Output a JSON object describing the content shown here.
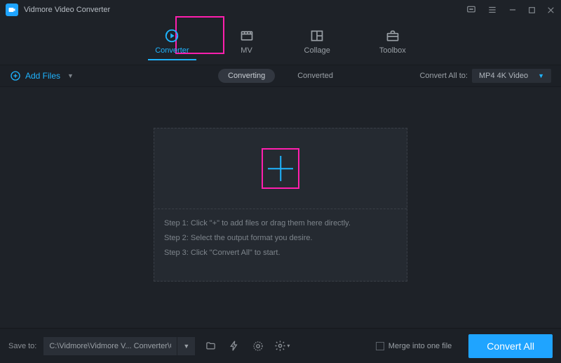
{
  "app": {
    "title": "Vidmore Video Converter"
  },
  "tabs": {
    "converter": "Converter",
    "mv": "MV",
    "collage": "Collage",
    "toolbox": "Toolbox"
  },
  "toolbar": {
    "add_files": "Add Files",
    "converting": "Converting",
    "converted": "Converted",
    "convert_all_to": "Convert All to:",
    "format_selected": "MP4 4K Video"
  },
  "dropzone": {
    "step1": "Step 1: Click \"+\" to add files or drag them here directly.",
    "step2": "Step 2: Select the output format you desire.",
    "step3": "Step 3: Click \"Convert All\" to start."
  },
  "footer": {
    "save_to": "Save to:",
    "path": "C:\\Vidmore\\Vidmore V... Converter\\Converted",
    "merge_label": "Merge into one file",
    "convert_all": "Convert All"
  }
}
